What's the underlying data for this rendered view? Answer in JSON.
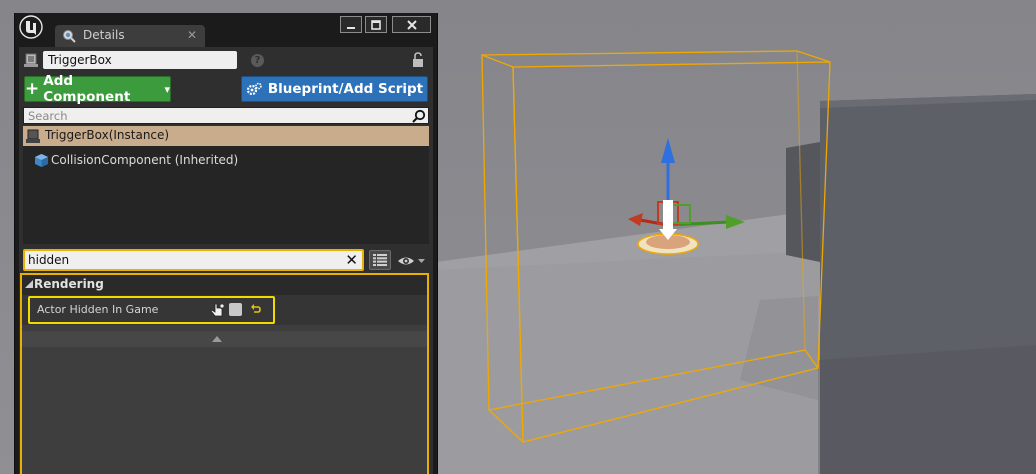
{
  "window": {
    "tab_label": "Details",
    "tab_close": "✕",
    "controls": {
      "minimize": "▁",
      "maximize": "▭",
      "close": "✕"
    }
  },
  "actor": {
    "name": "TriggerBox",
    "help": "?"
  },
  "toolbar": {
    "add_component_label": "Add Component",
    "add_plus": "+",
    "add_caret": "▾",
    "blueprint_label": "Blueprint/Add Script"
  },
  "component_search": {
    "placeholder": "Search"
  },
  "components": [
    {
      "label": "TriggerBox(Instance)",
      "selected": true
    },
    {
      "label": "CollisionComponent (Inherited)",
      "selected": false
    }
  ],
  "property_search": {
    "value": "hidden",
    "clear": "✕"
  },
  "categories": [
    {
      "label": "Rendering",
      "properties": [
        {
          "label": "Actor Hidden In Game",
          "checked": false
        }
      ]
    }
  ],
  "colors": {
    "highlight": "#e8b000",
    "property_highlight": "#f0dc00",
    "add_button": "#3c9b3c",
    "blueprint_button": "#2d72b8",
    "selected_row": "#c9ac8b",
    "trigger_box_outline": "#f0a800"
  },
  "icons": {
    "logo": "unreal-logo-icon",
    "tab": "details-icon",
    "actor": "actor-icon",
    "help": "help-icon",
    "lock": "lock-icon",
    "blueprint": "gears-icon",
    "search": "search-icon",
    "component": "cube-icon",
    "view_options": "eye-icon",
    "grid": "list-grid-icon",
    "reset": "reset-arrow-icon",
    "pointer": "pointer-icon"
  }
}
